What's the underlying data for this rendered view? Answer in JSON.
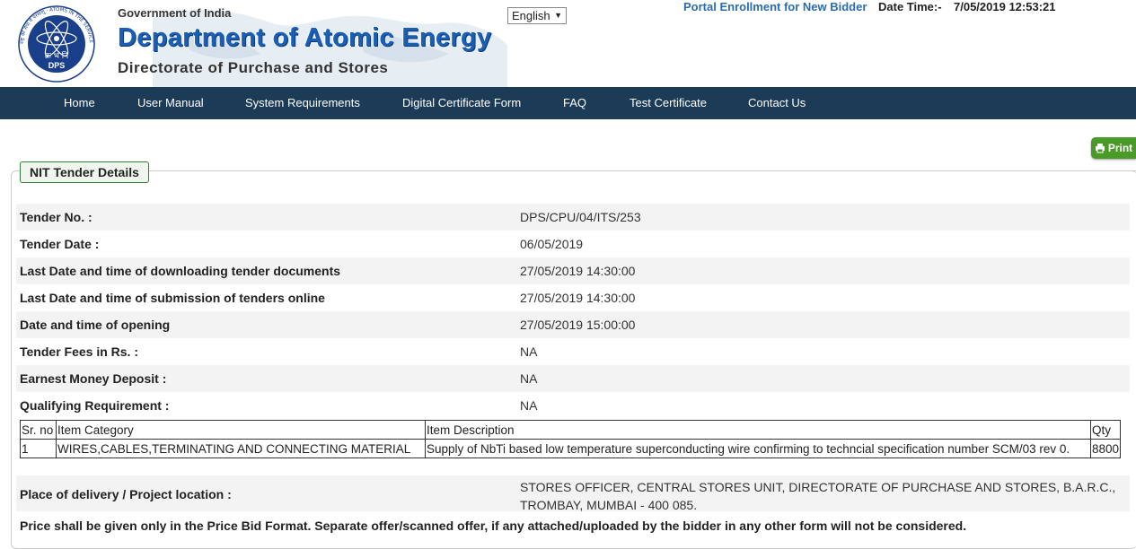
{
  "header": {
    "logo_text": "क्र भं नि",
    "logo_sub": "DPS",
    "logo_ring": "राष्ट्र की सेवा में परमाणु · ATOMS IN THE SERVICE OF THE NATION",
    "gov": "Government of India",
    "dept": "Department of Atomic Energy",
    "directorate": "Directorate of Purchase and Stores",
    "language": "English",
    "enroll_link": "Portal Enrollment for New Bidder",
    "datetime_label": "Date Time:-",
    "datetime_value": "7/05/2019 12:53:21"
  },
  "nav": [
    "Home",
    "User Manual",
    "System Requirements",
    "Digital Certificate Form",
    "FAQ",
    "Test Certificate",
    "Contact Us"
  ],
  "print_label": "Print",
  "section_title": "NIT Tender Details",
  "details": [
    {
      "label": "Tender No. :",
      "value": "DPS/CPU/04/ITS/253"
    },
    {
      "label": "Tender Date :",
      "value": "06/05/2019"
    },
    {
      "label": "Last Date and time of downloading tender documents",
      "value": "27/05/2019 14:30:00"
    },
    {
      "label": "Last Date and time of submission of tenders online",
      "value": "27/05/2019 14:30:00"
    },
    {
      "label": "Date and time of opening",
      "value": "27/05/2019 15:00:00"
    },
    {
      "label": "Tender Fees in Rs. :",
      "value": "NA"
    },
    {
      "label": "Earnest Money Deposit :",
      "value": "NA"
    },
    {
      "label": "Qualifying Requirement :",
      "value": "NA"
    }
  ],
  "items_table": {
    "headers": [
      "Sr. no",
      "Item Category",
      "Item Description",
      "Qty"
    ],
    "rows": [
      [
        "1",
        "WIRES,CABLES,TERMINATING AND CONNECTING MATERIAL",
        "Supply of NbTi based low temperature superconducting wire confirming to techncial specification number SCM/03 rev 0.",
        "8800"
      ]
    ]
  },
  "delivery": {
    "label": "Place of delivery / Project location :",
    "value": "STORES OFFICER, CENTRAL STORES UNIT, DIRECTORATE OF PURCHASE AND STORES, B.A.R.C., TROMBAY, MUMBAI - 400 085."
  },
  "price_note": "Price shall be given only in the Price Bid Format. Separate offer/scanned offer, if any attached/uploaded by the bidder in any other form will not be considered."
}
